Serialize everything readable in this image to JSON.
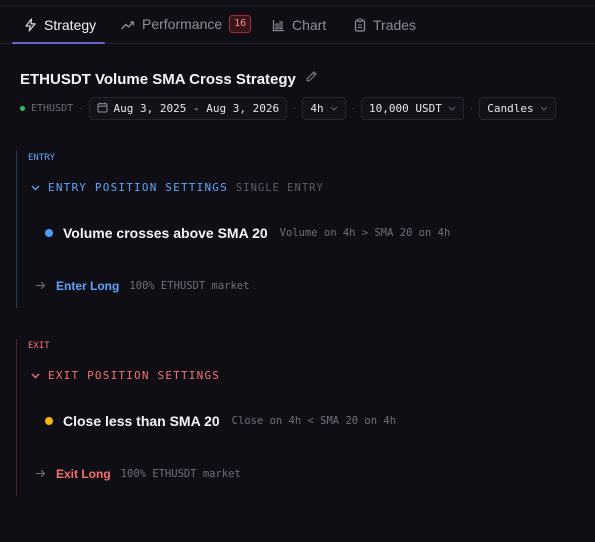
{
  "tabs": [
    {
      "label": "Strategy",
      "icon": "lightning-icon"
    },
    {
      "label": "Performance",
      "icon": "trend-icon",
      "badge": "16"
    },
    {
      "label": "Chart",
      "icon": "chart-icon"
    },
    {
      "label": "Trades",
      "icon": "clipboard-icon"
    }
  ],
  "strategy": {
    "title": "ETHUSDT Volume SMA Cross Strategy",
    "symbol": "ETHUSDT",
    "date_range": "Aug 3, 2025 - Aug 3, 2026",
    "timeframe": "4h",
    "capital": "10,000 USDT",
    "chart_type": "Candles"
  },
  "entry": {
    "label": "ENTRY",
    "header": "ENTRY POSITION SETTINGS",
    "subheader": "SINGLE ENTRY",
    "condition_title": "Volume crosses above SMA 20",
    "condition_desc": "Volume on 4h > SMA 20 on 4h",
    "action_name": "Enter Long",
    "action_desc": "100% ETHUSDT market"
  },
  "exit": {
    "label": "EXIT",
    "header": "EXIT POSITION SETTINGS",
    "condition_title": "Close less than SMA 20",
    "condition_desc": "Close on 4h < SMA 20 on 4h",
    "action_name": "Exit Long",
    "action_desc": "100% ETHUSDT market"
  },
  "colors": {
    "entry_accent": "#60a5fa",
    "exit_accent": "#f87171",
    "entry_dot": "#4f9cf5",
    "exit_dot": "#f5b50b",
    "tab_indicator": "#6a66c9",
    "status_dot": "#22c55e"
  }
}
